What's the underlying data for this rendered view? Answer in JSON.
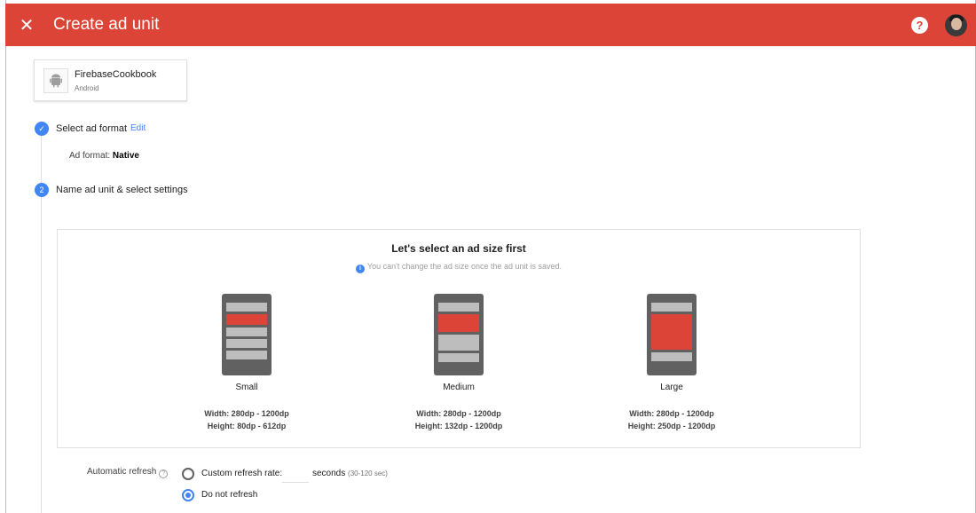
{
  "header": {
    "title": "Create ad unit",
    "close_icon": "close-icon",
    "help_icon": "help-icon",
    "help_glyph": "?"
  },
  "app": {
    "name": "FirebaseCookbook",
    "platform": "Android",
    "icon": "android-icon"
  },
  "steps": [
    {
      "number": "✓",
      "label": "Select ad format",
      "edit_label": "Edit",
      "format_prefix": "Ad format:",
      "format_value": "Native"
    },
    {
      "number": "2",
      "label": "Name ad unit & select settings"
    }
  ],
  "ad_size": {
    "title": "Let's select an ad size first",
    "note": "You can't change the ad size once the ad unit is saved.",
    "options": [
      {
        "label": "Small",
        "width": "Width: 280dp - 1200dp",
        "height": "Height: 80dp - 612dp"
      },
      {
        "label": "Medium",
        "width": "Width: 280dp - 1200dp",
        "height": "Height: 132dp - 1200dp"
      },
      {
        "label": "Large",
        "width": "Width: 280dp - 1200dp",
        "height": "Height: 250dp - 1200dp"
      }
    ]
  },
  "refresh": {
    "label": "Automatic refresh",
    "option_custom": "Custom refresh rate:",
    "seconds_label": "seconds",
    "seconds_hint": "(30-120 sec)",
    "seconds_value": "",
    "option_none": "Do not refresh",
    "selected": "Do not refresh"
  },
  "colors": {
    "header_bg": "#db4437",
    "accent_blue": "#4285f4",
    "ad_red": "#db4437"
  }
}
